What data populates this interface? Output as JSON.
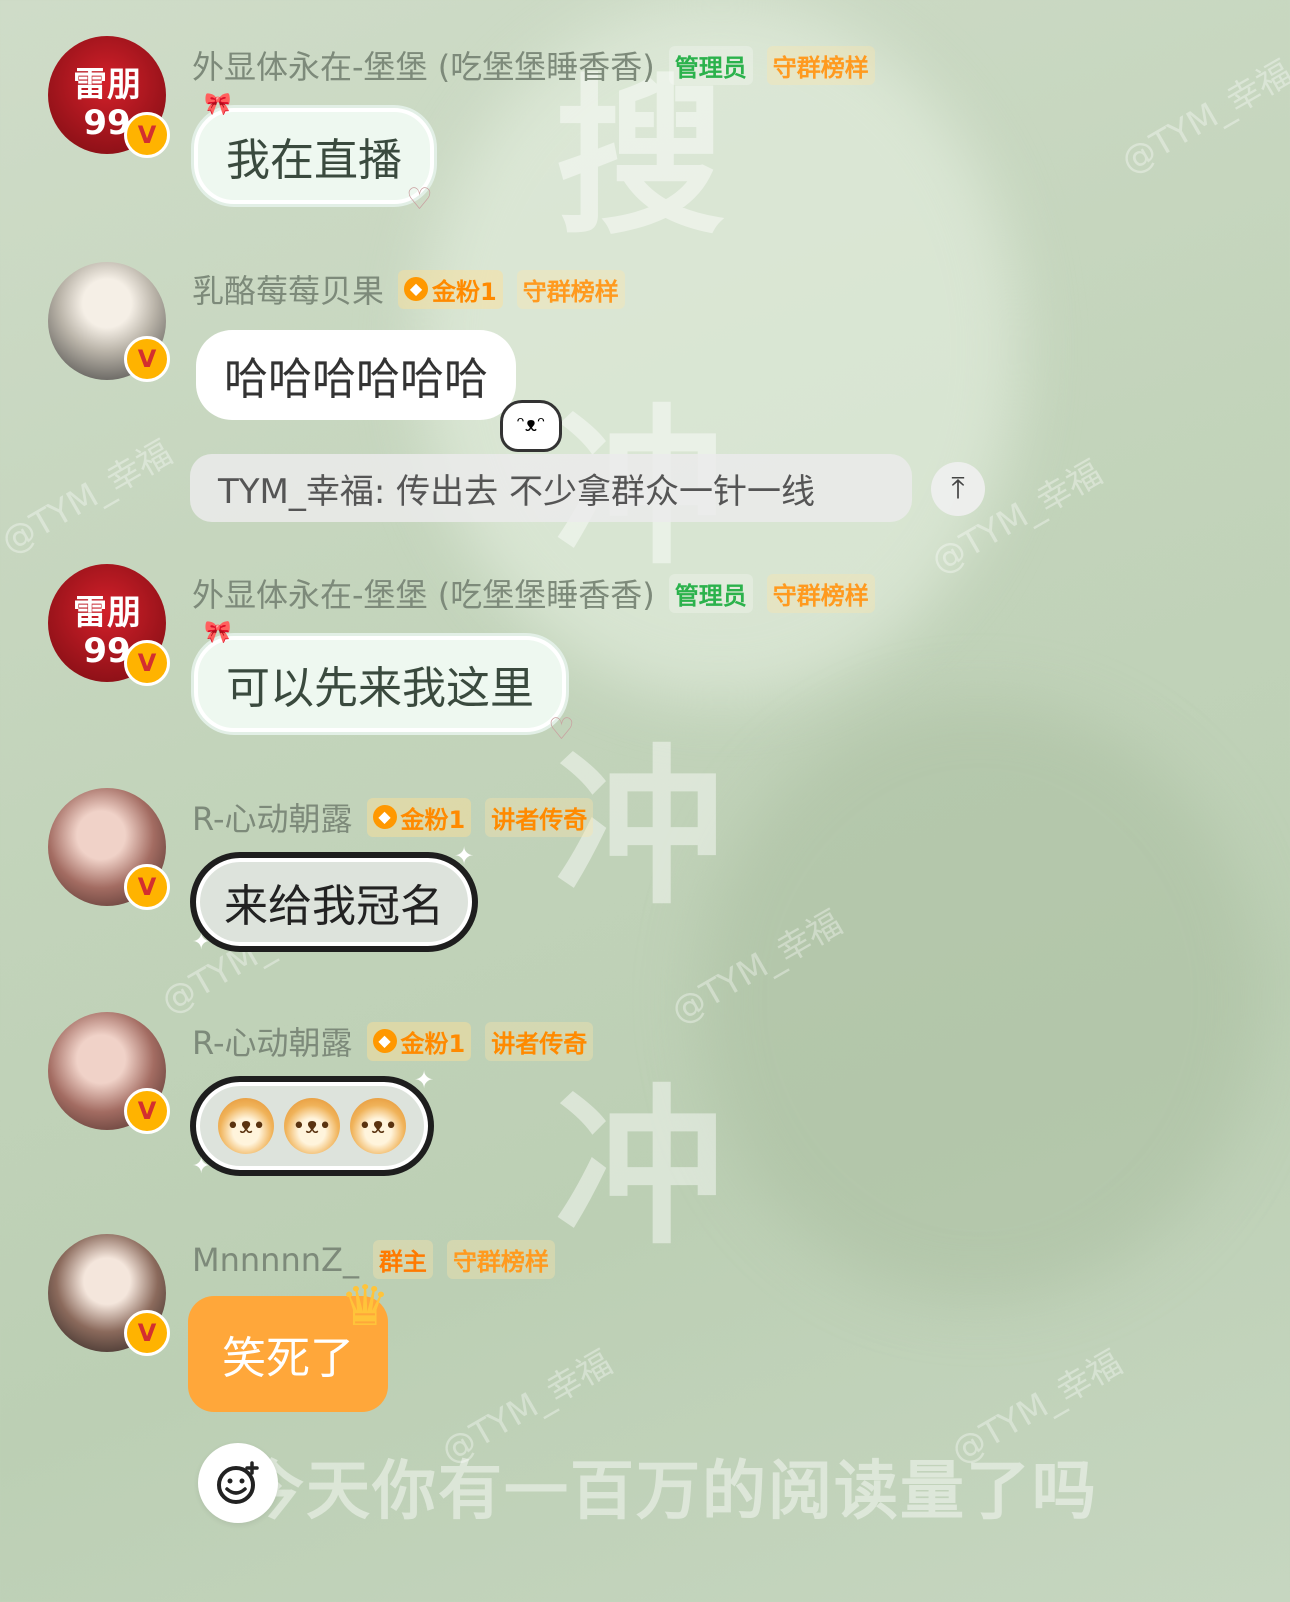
{
  "background": {
    "watermarks": [
      "@TYM_幸福"
    ],
    "big_chars": [
      "搜",
      "冲",
      "冲",
      "冲"
    ],
    "caption": "今天你有一百万的阅读量了吗"
  },
  "messages": [
    {
      "name": "外显体永在-堡堡 (吃堡堡睡香香)",
      "tags": [
        "管理员",
        "守群榜样"
      ],
      "avatar_text": "雷朋99",
      "text": "我在直播"
    },
    {
      "name": "乳酪莓莓贝果",
      "fan_tag": "金粉1",
      "tags": [
        "守群榜样"
      ],
      "text": "哈哈哈哈哈哈"
    },
    {
      "name": "外显体永在-堡堡 (吃堡堡睡香香)",
      "tags": [
        "管理员",
        "守群榜样"
      ],
      "avatar_text": "雷朋99",
      "text": "可以先来我这里"
    },
    {
      "name": "R-心动朝露",
      "fan_tag": "金粉1",
      "tags": [
        "讲者传奇"
      ],
      "text": "来给我冠名"
    },
    {
      "name": "R-心动朝露",
      "fan_tag": "金粉1",
      "tags": [
        "讲者传奇"
      ],
      "emojis": [
        "dog-emoji",
        "dog-emoji",
        "dog-emoji"
      ]
    },
    {
      "name": "MnnnnnZ_",
      "tags": [
        "群主",
        "守群榜样"
      ],
      "text": "笑死了"
    }
  ],
  "quote": {
    "text": "TYM_幸福: 传出去 不少拿群众一针一线"
  },
  "icons": {
    "vip": "V",
    "scroll_top": "⤒",
    "emoji_button": "emoji-plus-icon"
  },
  "colors": {
    "admin": "#2bb24c",
    "guard": "#ff9a1f",
    "owner_bubble": "#ffa73a"
  }
}
